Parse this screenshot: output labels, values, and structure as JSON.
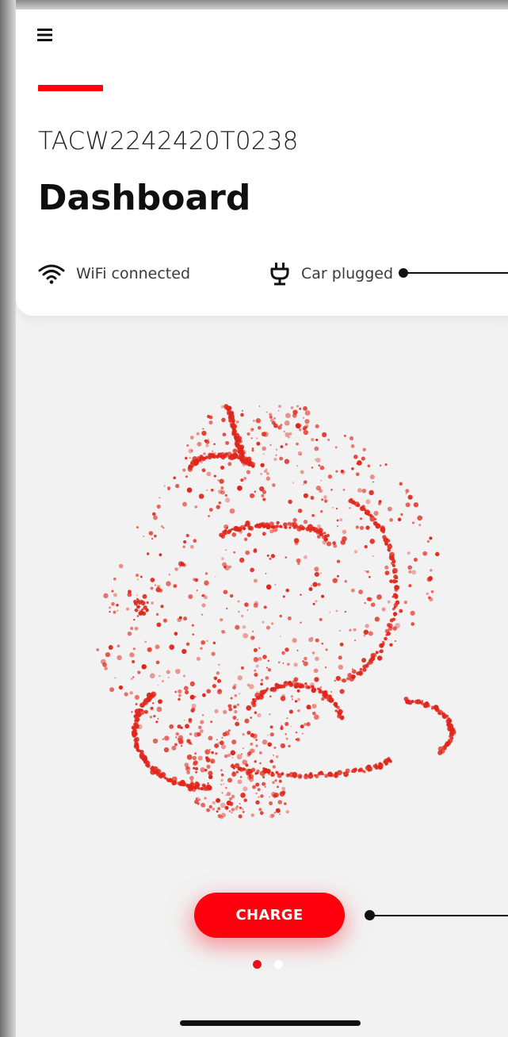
{
  "colors": {
    "accent": "#ff000f",
    "particle": "#e0261a",
    "page_dot_active": "#e8101e",
    "page_dot_inactive": "#ffffff"
  },
  "header": {
    "menu_icon": "hamburger-menu-icon",
    "device_id": "TACW2242420T0238",
    "title": "Dashboard"
  },
  "status": {
    "wifi": {
      "icon": "wifi-icon",
      "label": "WiFi connected"
    },
    "car": {
      "icon": "plug-icon",
      "label": "Car plugged"
    }
  },
  "main": {
    "charge_button_label": "CHARGE",
    "pages": {
      "count": 2,
      "active": 0
    }
  }
}
